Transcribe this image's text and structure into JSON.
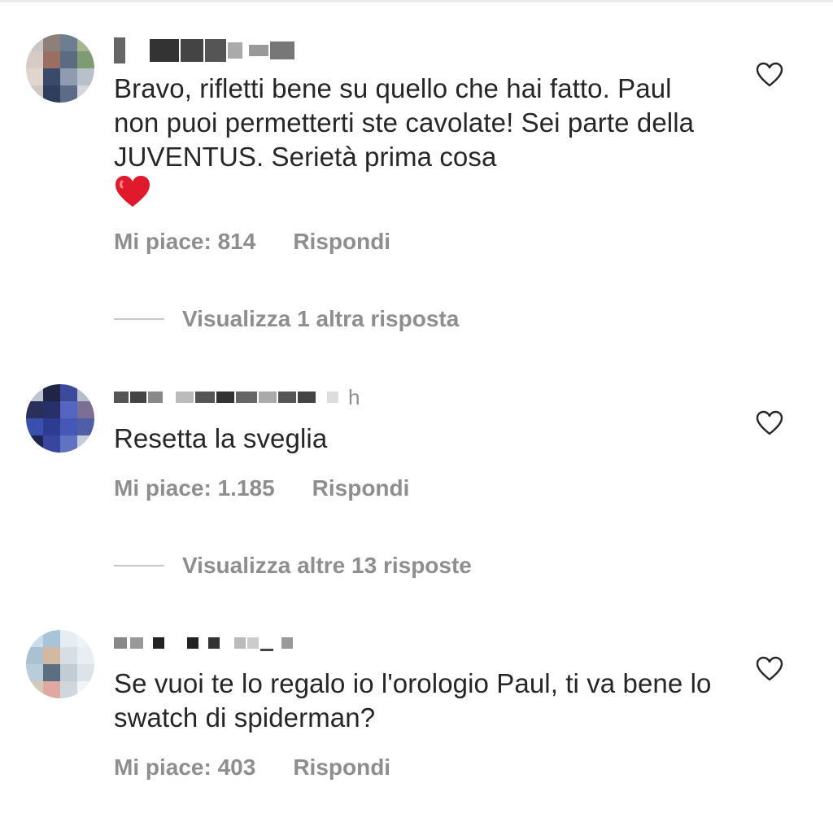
{
  "comments": [
    {
      "text": "Bravo, rifletti bene su quello che hai fatto. Paul non puoi permetterti ste cavolate! Sei parte della JUVENTUS. Serietà prima cosa",
      "emoji": "red-heart",
      "likes": "Mi piace: 814",
      "reply": "Rispondi",
      "more_replies": "Visualizza 1 altra risposta"
    },
    {
      "time_suffix": "h",
      "text": "Resetta la sveglia",
      "likes": "Mi piace: 1.185",
      "reply": "Rispondi",
      "more_replies": "Visualizza altre 13 risposte"
    },
    {
      "text": "Se vuoi te lo regalo io l'orologio Paul, ti va bene lo swatch di spiderman?",
      "likes": "Mi piace: 403",
      "reply": "Rispondi"
    }
  ],
  "colors": {
    "text": "#262626",
    "secondary": "#8e8e8e",
    "divider": "#c7c7c7",
    "heart": "#e0192d"
  },
  "icons": {
    "like": "heart-outline-icon",
    "emoji": "red-heart-emoji"
  }
}
